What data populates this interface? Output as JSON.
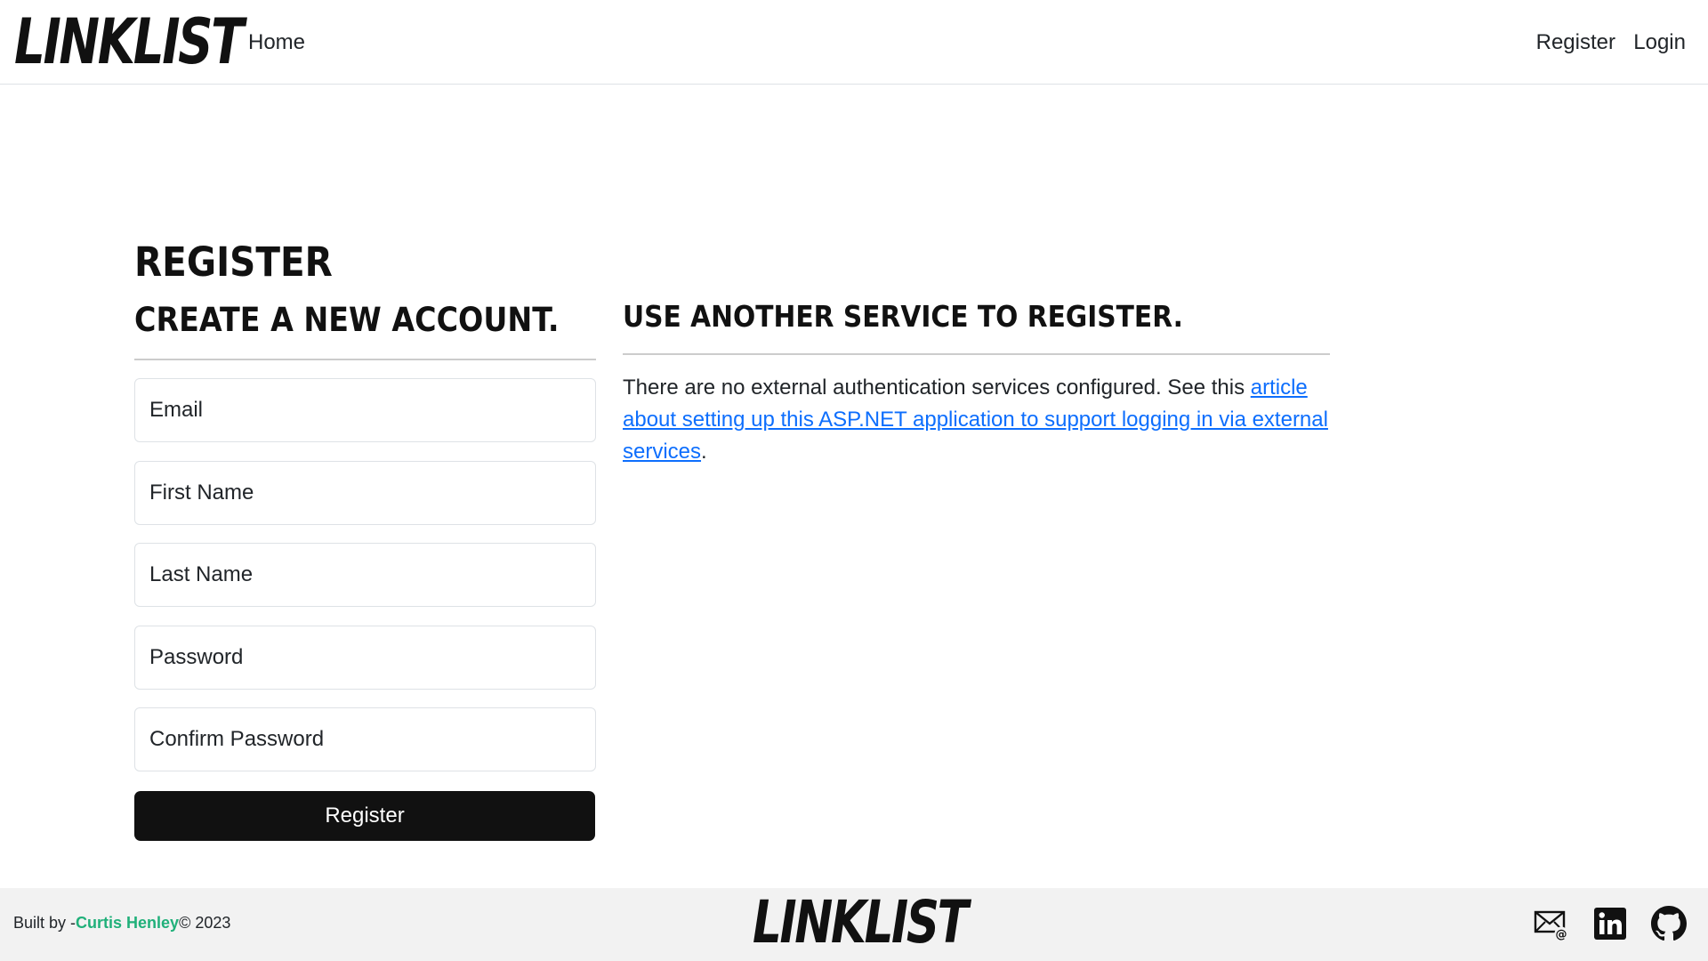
{
  "header": {
    "logo_text": "LINKLIST",
    "nav_home": "Home",
    "nav_register": "Register",
    "nav_login": "Login"
  },
  "main": {
    "title": "REGISTER",
    "form_heading": "CREATE A NEW ACCOUNT.",
    "fields": {
      "email_placeholder": "Email",
      "first_name_placeholder": "First Name",
      "last_name_placeholder": "Last Name",
      "password_placeholder": "Password",
      "confirm_password_placeholder": "Confirm Password"
    },
    "submit_label": "Register",
    "external": {
      "heading": "USE ANOTHER SERVICE TO REGISTER.",
      "text_before": "There are no external authentication services configured. See this ",
      "link_text": "article about setting up this ASP.NET application to support logging in via external services",
      "text_after": "."
    }
  },
  "footer": {
    "built_by_prefix": "Built by -",
    "author": "Curtis Henley",
    "copyright": "© 2023",
    "logo_text": "LINKLIST",
    "icons": [
      "email-icon",
      "linkedin-icon",
      "github-icon"
    ]
  },
  "colors": {
    "link": "#0d6efd",
    "author": "#20b07a",
    "button": "#111111",
    "footer_bg": "#f2f2f2"
  }
}
